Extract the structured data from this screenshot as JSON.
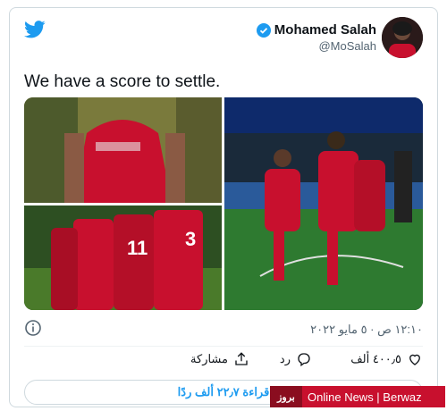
{
  "header": {
    "display_name": "Mohamed Salah",
    "handle": "@MoSalah"
  },
  "tweet": {
    "text": "We have a score to settle.",
    "timestamp": "١٢:١٠ ص · ٥ مايو ٢٠٢٢"
  },
  "actions": {
    "likes": "٤٠٠٫٥ ألف",
    "reply_label": "رد",
    "share_label": "مشاركة"
  },
  "reply_bar": {
    "label": "قراءة ٢٢٫٧ ألف ردًا"
  },
  "watermark": {
    "text": "Online News | Berwaz",
    "logo_text": "بروز"
  },
  "colors": {
    "accent": "#1d9bf0",
    "liverpool_red": "#c8102e"
  },
  "icons": [
    "twitter-bird-icon",
    "verified-icon",
    "info-icon",
    "heart-icon",
    "reply-icon",
    "share-icon"
  ]
}
